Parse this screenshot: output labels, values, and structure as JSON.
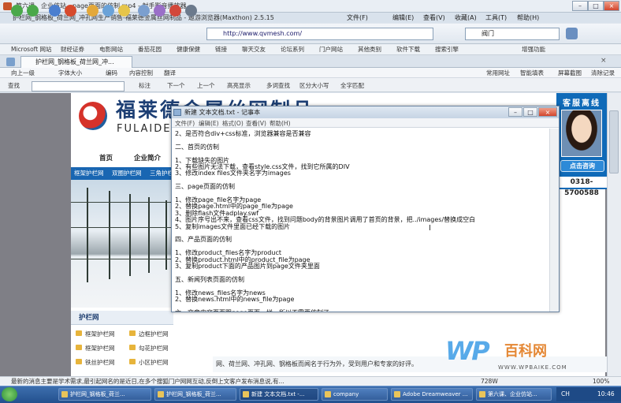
{
  "player": {
    "title": "第六课、企业仿站，page页面的仿制.mp4 - 射手影音播放器"
  },
  "browser": {
    "window_title": "护栏网_钢格板_荷兰网_冲孔网生产销售-福莱德金属丝网制品 - 遨游浏览器(Maxthon) 2.5.15",
    "menu": [
      "文件(F)",
      "编辑(E)",
      "查看(V)",
      "收藏(A)",
      "工具(T)",
      "帮助(H)"
    ],
    "url": "http://www.qvmesh.com/",
    "search_value": "阀门",
    "bookmarks": [
      "Microsoft 网站",
      "财经证券",
      "电影网站",
      "番茄花园",
      "健康保健",
      "链接",
      "聊天交友",
      "论坛系列",
      "门户网站",
      "其他类别",
      "软件下载",
      "搜索引擎",
      "增强功能"
    ],
    "tab_title": "护栏网_钢格板_荷兰网_冲...",
    "pagebar": [
      "向上一级",
      "字体大小",
      "编码",
      "内容控制",
      "翻译",
      "常用网址",
      "智能填表",
      "屏幕截图",
      "清除记录"
    ],
    "findbar": {
      "label": "查找",
      "items": [
        "标注",
        "下一个",
        "上一个",
        "高亮显示",
        "多词查找",
        "区分大小写",
        "全字匹配"
      ]
    },
    "status": "最新的消息主要是学术需求,最引起网名的是近日,在多个搜狐门户网网互动,反倒上文客户发布消息说,有...",
    "zoom": "728W",
    "zoom_pct": "100%"
  },
  "site": {
    "logo_cn": "福莱德金属丝网制品",
    "logo_en": "FULAIDE M",
    "nav": [
      "首页",
      "企业简介"
    ],
    "subnav": [
      "框架护栏网",
      "双圈护栏网",
      "三角护栏"
    ],
    "side_heading": "护栏网",
    "side_links": [
      "框架护栏网",
      "边框护栏网",
      "框架护栏网",
      "勾花护栏网",
      "铁丝护栏网",
      "小区护栏网"
    ],
    "service_title": "客服离线",
    "consult": "点击咨询",
    "phone": "0318-5700588",
    "footer": "网、荷兰网、冲孔网、钢格板而闻名于行为外，受到用户和专家的好评。"
  },
  "notepad": {
    "title": "新建 文本文档.txt - 记事本",
    "menu": [
      "文件(F)",
      "编辑(E)",
      "格式(O)",
      "查看(V)",
      "帮助(H)"
    ],
    "lines": [
      "2、是否符合div+css标准，浏览器兼容是否兼容",
      "",
      "二、首页的仿制",
      "",
      "1、下载缺失的图片",
      "2、有些图片无法下载，查看style.css文件，找到它所属的DIV",
      "3、修改index files文件夹名字为images",
      "",
      "三、page页面的仿制",
      "",
      "1、修改page_file名字为page",
      "2、替换page.html中的page_file为page",
      "3、删除flash文件adplay.swf",
      "4、图片序号出不来，查看css文件，找到问题body的背景图片调用了首页的背景，把../images/替换成空白",
      "5、复制images文件里面已经下载的图片",
      "",
      "四、产品页面的仿制",
      "",
      "1、修改product_files名字为product",
      "2、替换product.html中的product_file为page",
      "3、复制product下面的产品图片到page文件夹里面",
      "",
      "五、新闻列表页面的仿制",
      "",
      "1、修改news_files名字为news",
      "2、替换news.html中的news_file为page",
      "",
      "六、文章内容页面跟page页面一样，所以不需要仿制了"
    ]
  },
  "watermark": {
    "main": "WP",
    "cn": "百科网",
    "domain": "WWW.WPBAIKE.COM"
  },
  "taskbar": {
    "tasks": [
      "护栏网_钢格板_荷兰...",
      "护栏网_钢格板_荷兰...",
      "新建 文本文档.txt -...",
      "company",
      "Adobe Dreamweaver ...",
      "第六课、企业仿站..."
    ],
    "lang": "CH",
    "time": "10:46"
  }
}
